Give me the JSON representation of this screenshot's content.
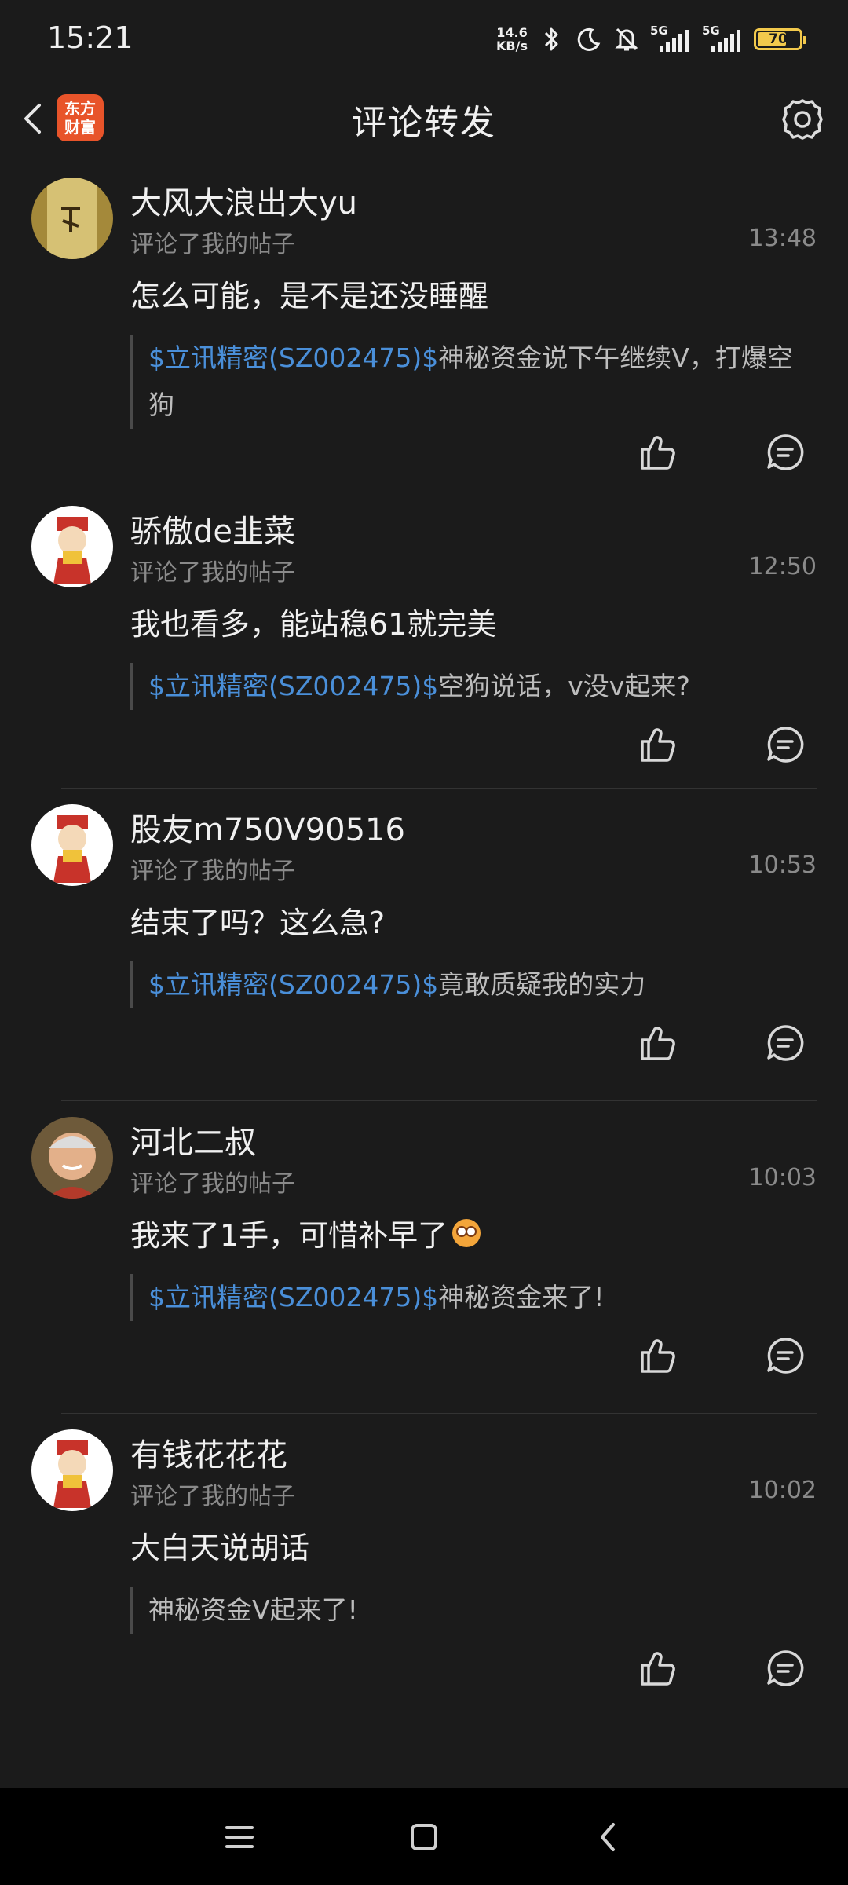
{
  "status_bar": {
    "time": "15:21",
    "net_speed_value": "14.6",
    "net_speed_unit": "KB/s",
    "sim1": "5G",
    "sim2": "5G",
    "battery": "70",
    "battery_level": 0.7,
    "accent": "#f2c94c"
  },
  "header": {
    "logo_line1": "东方",
    "logo_line2": "财富",
    "title": "评论转发"
  },
  "colors": {
    "background": "#1b1b1b",
    "link": "#4a8fd9",
    "logo": "#e8542a"
  },
  "comments": [
    {
      "user": "大风大浪出大yu",
      "action": "评论了我的帖子",
      "time": "13:48",
      "content": "怎么可能，是不是还没睡醒",
      "quote_link": "$立讯精密(SZ002475)$",
      "quote_text": "神秘资金说下午继续V，打爆空狗"
    },
    {
      "user": "骄傲de韭菜",
      "action": "评论了我的帖子",
      "time": "12:50",
      "content": "我也看多，能站稳61就完美",
      "quote_link": "$立讯精密(SZ002475)$",
      "quote_text": "空狗说话，v没v起来?"
    },
    {
      "user": "股友m750V90516",
      "action": "评论了我的帖子",
      "time": "10:53",
      "content": "结束了吗？这么急?",
      "quote_link": "$立讯精密(SZ002475)$",
      "quote_text": "竟敢质疑我的实力"
    },
    {
      "user": "河北二叔",
      "action": "评论了我的帖子",
      "time": "10:03",
      "content": "我来了1手，可惜补早了",
      "quote_link": "$立讯精密(SZ002475)$",
      "quote_text": "神秘资金来了!"
    },
    {
      "user": "有钱花花花",
      "action": "评论了我的帖子",
      "time": "10:02",
      "content": "大白天说胡话",
      "quote_link": "",
      "quote_text": "神秘资金V起来了!"
    }
  ]
}
